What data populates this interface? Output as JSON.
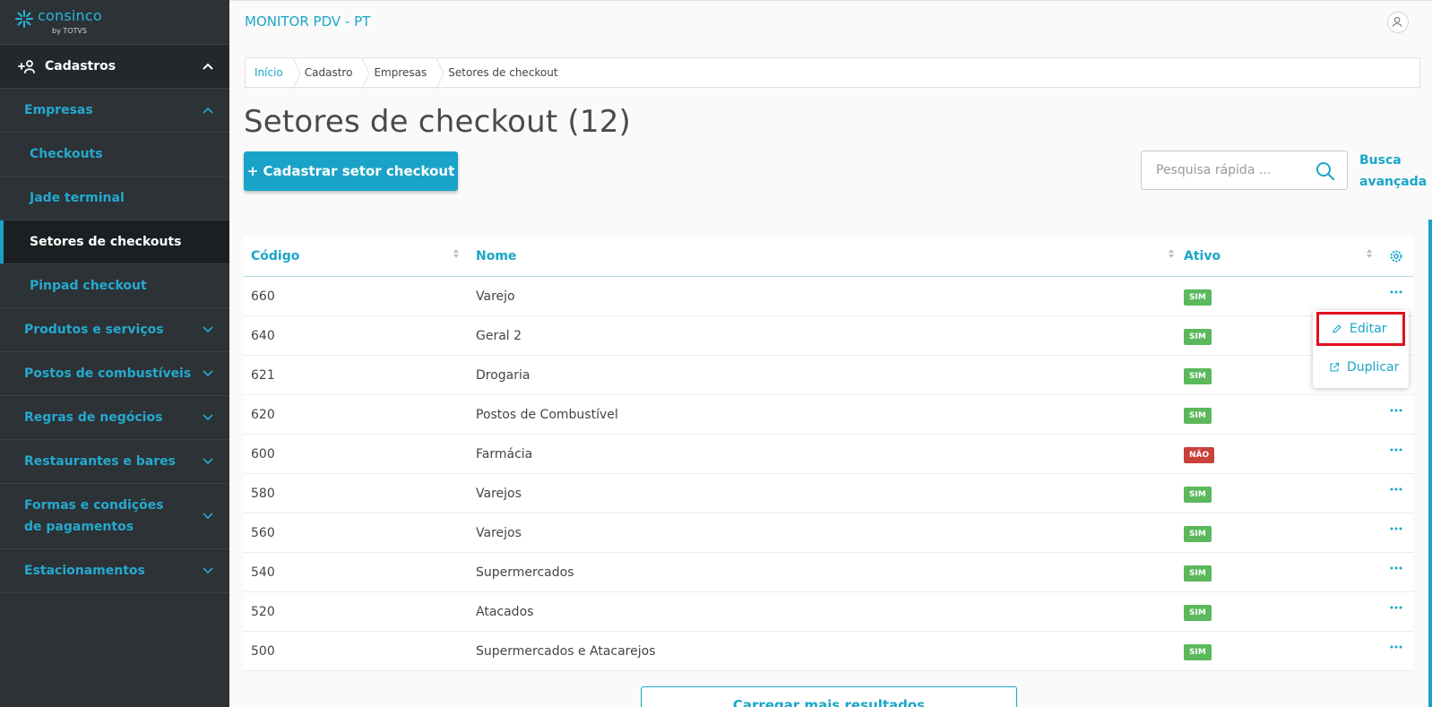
{
  "brand": {
    "name": "consinco",
    "sub": "by TOTVS"
  },
  "header": {
    "app_title": "MONITOR PDV - PT"
  },
  "sidebar": {
    "top": {
      "label": "Cadastros"
    },
    "items": [
      {
        "label": "Empresas"
      },
      {
        "label": "Checkouts"
      },
      {
        "label": "Jade terminal"
      },
      {
        "label": "Setores de checkouts"
      },
      {
        "label": "Pinpad checkout"
      },
      {
        "label": "Produtos e serviços"
      },
      {
        "label": "Postos de combustíveis"
      },
      {
        "label": "Regras de negócios"
      },
      {
        "label": "Restaurantes e bares"
      },
      {
        "label": "Formas e condições de pagamentos"
      },
      {
        "label": "Estacionamentos"
      }
    ]
  },
  "breadcrumb": [
    "Início",
    "Cadastro",
    "Empresas",
    "Setores de checkout"
  ],
  "page": {
    "title": "Setores de checkout (12)",
    "add_button": "+  Cadastrar setor checkout",
    "search_placeholder": "Pesquisa rápida ...",
    "advanced_search": "Busca avançada"
  },
  "table": {
    "columns": [
      "Código",
      "Nome",
      "Ativo"
    ],
    "rows": [
      {
        "code": "660",
        "name": "Varejo",
        "active": "SIM"
      },
      {
        "code": "640",
        "name": "Geral 2",
        "active": "SIM"
      },
      {
        "code": "621",
        "name": "Drogaria",
        "active": "SIM"
      },
      {
        "code": "620",
        "name": "Postos de Combustível",
        "active": "SIM"
      },
      {
        "code": "600",
        "name": "Farmácia",
        "active": "NÃO"
      },
      {
        "code": "580",
        "name": "Varejos",
        "active": "SIM"
      },
      {
        "code": "560",
        "name": "Varejos",
        "active": "SIM"
      },
      {
        "code": "540",
        "name": "Supermercados",
        "active": "SIM"
      },
      {
        "code": "520",
        "name": "Atacados",
        "active": "SIM"
      },
      {
        "code": "500",
        "name": "Supermercados e Atacarejos",
        "active": "SIM"
      }
    ]
  },
  "row_menu": {
    "edit": "Editar",
    "duplicate": "Duplicar"
  },
  "load_more": "Carregar mais resultados",
  "colors": {
    "accent": "#1aa3c9",
    "sidebar": "#2c3236",
    "success": "#5cb85c",
    "danger": "#c9413b",
    "highlight": "#e00f1e"
  }
}
